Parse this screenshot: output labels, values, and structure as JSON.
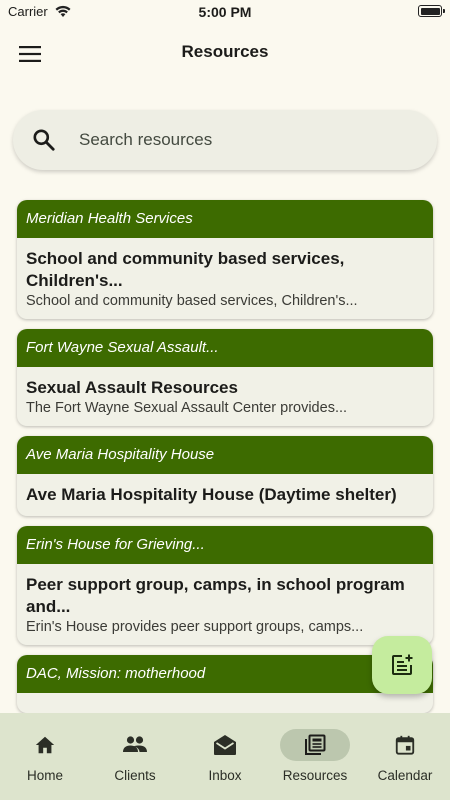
{
  "status": {
    "carrier": "Carrier",
    "time": "5:00 PM"
  },
  "header": {
    "title": "Resources"
  },
  "search": {
    "placeholder": "Search resources"
  },
  "resources": [
    {
      "org": "Meridian Health Services",
      "title": "School and community based services, Children's...",
      "desc": "School and community based services, Children's..."
    },
    {
      "org": "Fort Wayne Sexual Assault...",
      "title": "Sexual Assault Resources",
      "desc": "The Fort Wayne Sexual Assault Center provides..."
    },
    {
      "org": "Ave Maria Hospitality House",
      "title": "Ave Maria Hospitality House (Daytime shelter)",
      "desc": ""
    },
    {
      "org": "Erin's House for Grieving...",
      "title": "Peer support group, camps, in school program and...",
      "desc": "Erin's House provides peer support groups, camps..."
    },
    {
      "org": "DAC, Mission: motherhood",
      "title": "",
      "desc": ""
    }
  ],
  "nav": {
    "items": [
      {
        "label": "Home",
        "icon": "home-icon"
      },
      {
        "label": "Clients",
        "icon": "people-icon"
      },
      {
        "label": "Inbox",
        "icon": "mail-icon"
      },
      {
        "label": "Resources",
        "icon": "newspaper-icon",
        "active": true
      },
      {
        "label": "Calendar",
        "icon": "calendar-icon"
      }
    ]
  },
  "colors": {
    "primary": "#3d6b00",
    "background": "#fbf9ef",
    "nav_background": "#dde4cd",
    "fab": "#c5ec9e",
    "active_indicator": "#bcc7ae"
  }
}
